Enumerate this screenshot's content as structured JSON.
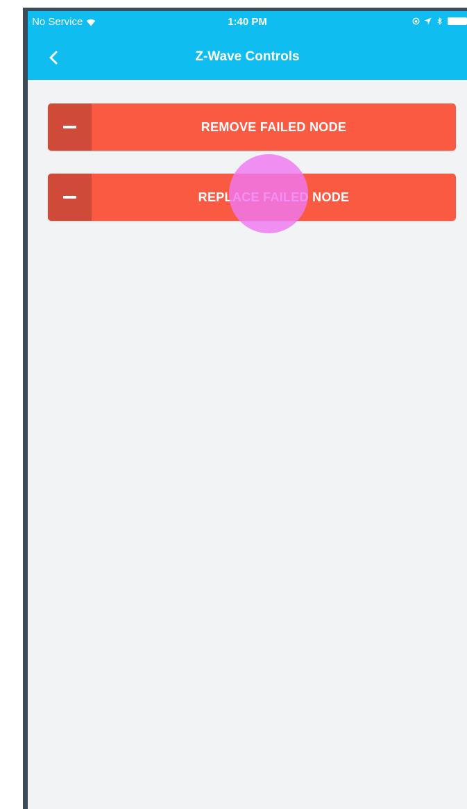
{
  "status_bar": {
    "carrier": "No Service",
    "time": "1:40 PM",
    "icons": [
      "wifi-icon",
      "rotation-lock-icon",
      "location-arrow-icon",
      "bluetooth-icon",
      "battery-icon"
    ]
  },
  "nav": {
    "title": "Z-Wave Controls",
    "back_icon": "chevron-left-icon"
  },
  "actions": [
    {
      "label": "REMOVE FAILED NODE",
      "icon": "minus-icon"
    },
    {
      "label": "REPLACE FAILED NODE",
      "icon": "minus-icon"
    }
  ],
  "colors": {
    "header": "#10bdf0",
    "button": "#fa5a42",
    "button_icon_block": "#cf4a39",
    "background": "#f1f3f4",
    "touch_indicator": "#f078f0"
  }
}
